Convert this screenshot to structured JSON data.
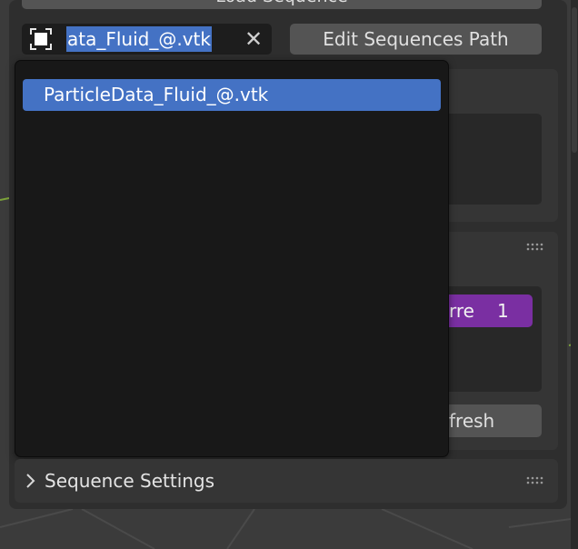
{
  "top_button": {
    "label": "Load Sequence"
  },
  "file_field": {
    "icon": "file-select-icon",
    "visible_text": "ata_Fluid_@.vtk",
    "clear_icon": "close-icon",
    "clear_glyph": "✕"
  },
  "edit_sequences_button": {
    "label": "Edit Sequences Path"
  },
  "dropdown": {
    "items": [
      {
        "label": "ParticleData_Fluid_@.vtk",
        "selected": true
      }
    ]
  },
  "chip": {
    "label": "rre",
    "value": "1"
  },
  "refresh_button": {
    "label": "fresh"
  },
  "sequence_settings": {
    "title": "Sequence Settings",
    "collapsed": true
  },
  "colors": {
    "accent": "#4472c4",
    "purple": "#7a2fa2",
    "panel": "#2e2e2e",
    "dropdown_bg": "#181818"
  }
}
